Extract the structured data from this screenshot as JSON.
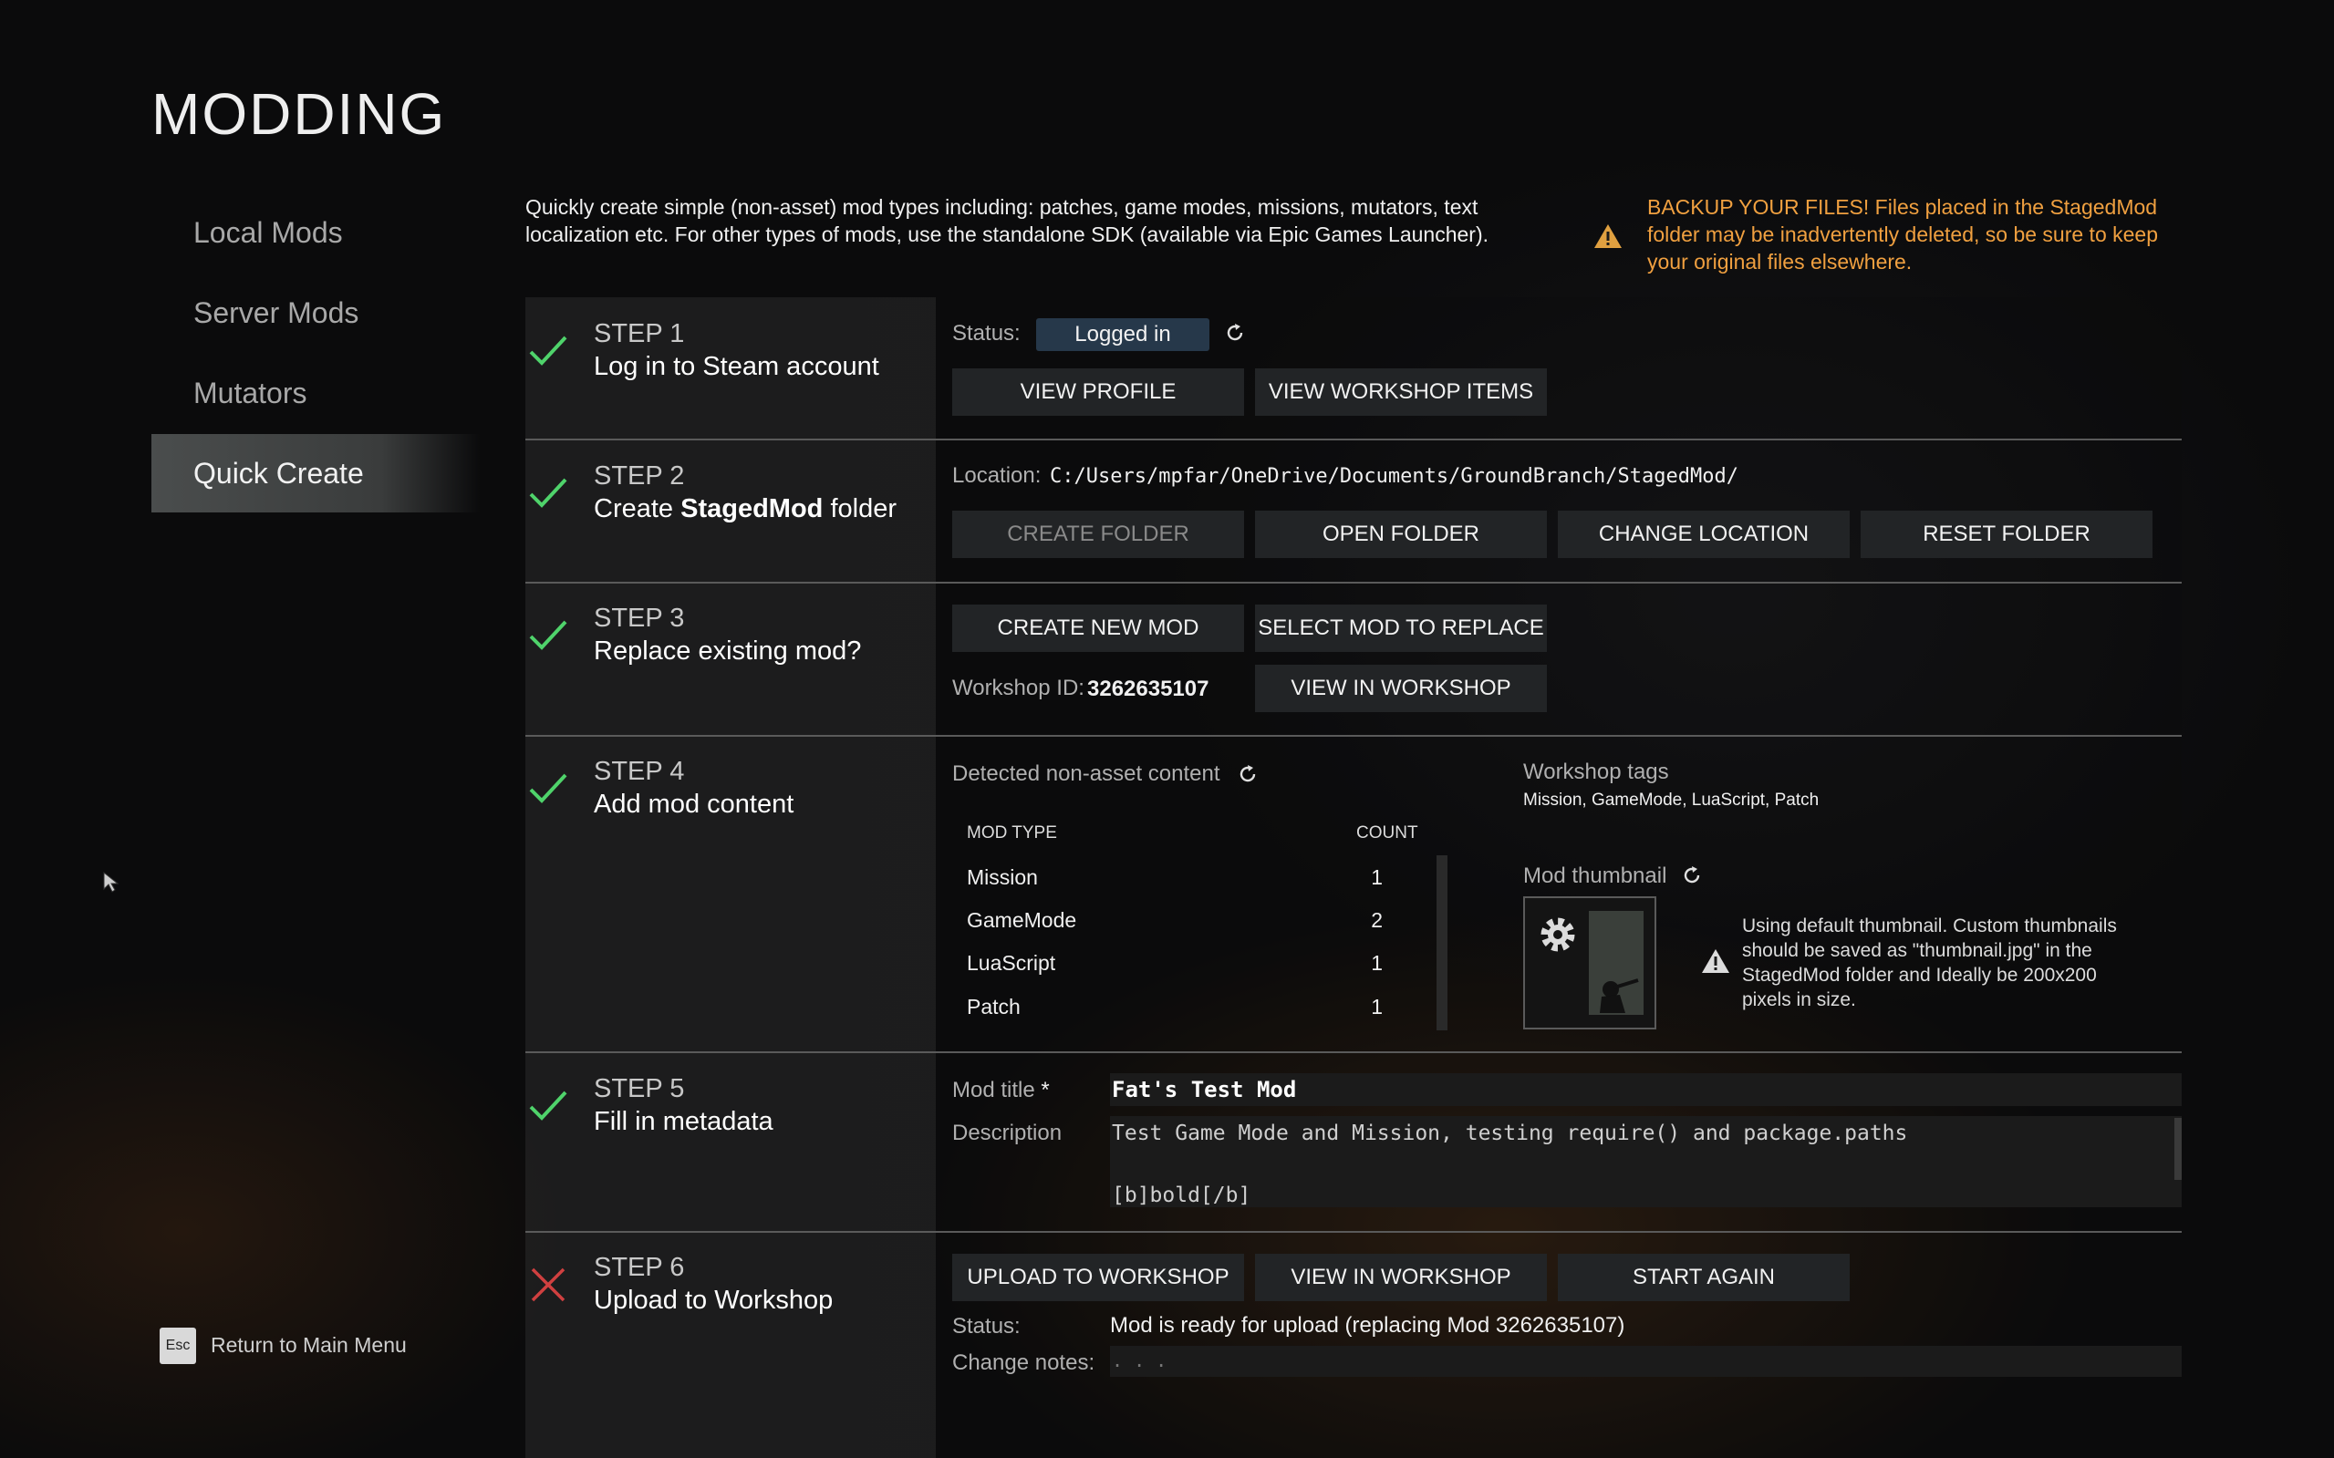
{
  "page": {
    "title": "MODDING"
  },
  "sidebar": {
    "items": [
      {
        "label": "Local Mods"
      },
      {
        "label": "Server Mods"
      },
      {
        "label": "Mutators"
      },
      {
        "label": "Quick Create",
        "active": true
      }
    ],
    "return": {
      "key": "Esc",
      "label": "Return to Main Menu"
    }
  },
  "intro": {
    "line1": "Quickly create simple (non-asset) mod types including: patches, game modes, missions, mutators, text",
    "line2": "localization etc. For other types of mods, use the standalone SDK (available via Epic Games Launcher)."
  },
  "warning": {
    "line1": "BACKUP YOUR FILES! Files placed in the StagedMod",
    "line2": "folder may be inadvertently deleted, so be sure to keep",
    "line3": "your original files elsewhere.",
    "color": "#f0a040"
  },
  "steps": [
    {
      "num": "STEP 1",
      "name": "Log in to Steam account",
      "state": "done",
      "status_label": "Status:",
      "status_value": "Logged in",
      "buttons": [
        "VIEW PROFILE",
        "VIEW WORKSHOP ITEMS"
      ]
    },
    {
      "num": "STEP 2",
      "name_pre": "Create ",
      "name_bold": "StagedMod",
      "name_post": " folder",
      "state": "done",
      "location_label": "Location:",
      "location_value": "C:/Users/mpfar/OneDrive/Documents/GroundBranch/StagedMod/",
      "buttons": [
        "CREATE FOLDER",
        "OPEN FOLDER",
        "CHANGE LOCATION",
        "RESET FOLDER"
      ]
    },
    {
      "num": "STEP 3",
      "name": "Replace existing mod?",
      "state": "done",
      "buttons": [
        "CREATE NEW MOD",
        "SELECT MOD TO REPLACE"
      ],
      "workshop_id_label": "Workshop ID:",
      "workshop_id_value": "3262635107",
      "view_button": "VIEW IN WORKSHOP"
    },
    {
      "num": "STEP 4",
      "name": "Add mod content",
      "state": "done",
      "detected_label": "Detected non-asset content",
      "table_headers": [
        "MOD TYPE",
        "COUNT"
      ],
      "rows": [
        {
          "type": "Mission",
          "count": "1"
        },
        {
          "type": "GameMode",
          "count": "2"
        },
        {
          "type": "LuaScript",
          "count": "1"
        },
        {
          "type": "Patch",
          "count": "1"
        }
      ],
      "tags_label": "Workshop tags",
      "tags_value": "Mission, GameMode, LuaScript, Patch",
      "thumbnail_label": "Mod thumbnail",
      "thumb_note_1": "Using default thumbnail. Custom thumbnails",
      "thumb_note_2": "should be saved as \"thumbnail.jpg\" in the",
      "thumb_note_3": "StagedMod folder and Ideally be 200x200",
      "thumb_note_4": "pixels in size."
    },
    {
      "num": "STEP 5",
      "name": "Fill in metadata",
      "state": "done",
      "title_label": "Mod title",
      "title_required": "*",
      "title_value": "Fat's Test Mod",
      "desc_label": "Description",
      "desc_line1": "Test Game Mode and Mission, testing require() and package.paths",
      "desc_line2": "[b]bold[/b]"
    },
    {
      "num": "STEP 6",
      "name": "Upload to Workshop",
      "state": "not-done",
      "buttons": [
        "UPLOAD TO WORKSHOP",
        "VIEW IN WORKSHOP",
        "START AGAIN"
      ],
      "status_label": "Status:",
      "status_value": "Mod is ready for upload (replacing Mod 3262635107)",
      "notes_label": "Change notes:",
      "notes_placeholder": ". . ."
    }
  ],
  "colors": {
    "check": "#4fd36b",
    "cross": "#d04040",
    "accent_pill": "#26384a"
  }
}
